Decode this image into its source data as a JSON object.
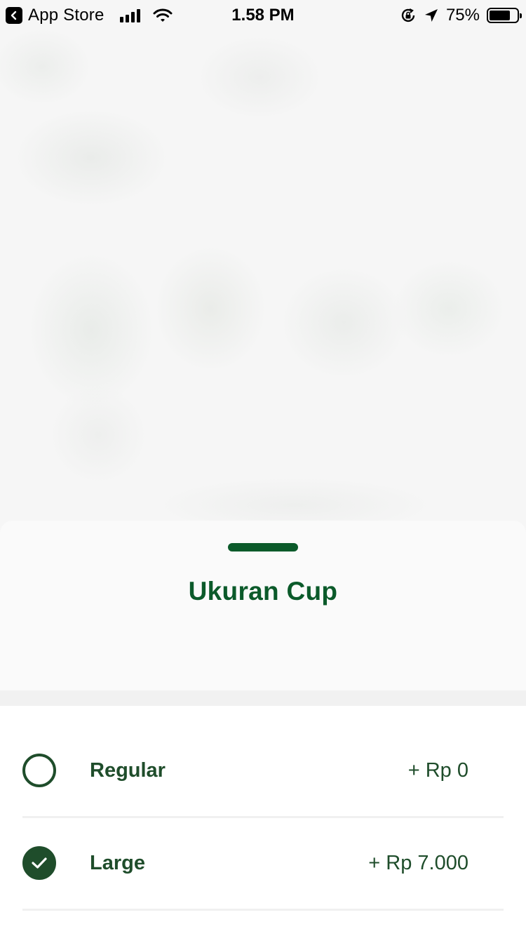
{
  "status_bar": {
    "back_app": "App Store",
    "time": "1.58 PM",
    "battery": "75%",
    "battery_level": 0.75
  },
  "sheet": {
    "title": "Ukuran Cup",
    "options": [
      {
        "name": "Regular",
        "price": "+ Rp 0",
        "selected": false
      },
      {
        "name": "Large",
        "price": "+ Rp 7.000",
        "selected": true
      }
    ]
  },
  "colors": {
    "brand_green": "#0b5a2a",
    "option_green": "#1f4d2b"
  },
  "icons": [
    "back-icon",
    "signal-icon",
    "wifi-icon",
    "orientation-lock-icon",
    "location-icon",
    "battery-icon",
    "radio-unchecked-icon",
    "check-icon"
  ]
}
